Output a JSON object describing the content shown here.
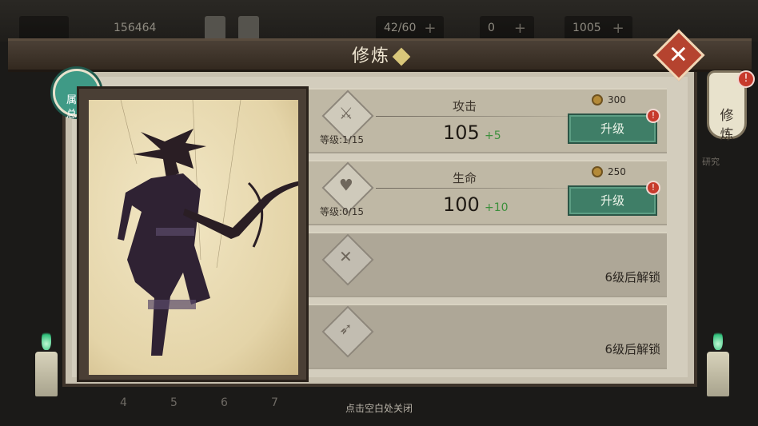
{
  "topbar": {
    "player_id": "156464",
    "stamina": "42/60",
    "currency_1": "0",
    "currency_2": "1005",
    "plus_symbol": "+"
  },
  "dialog": {
    "title": "修炼",
    "attribute_overview_label": "属性\n总览",
    "side_tab_label": "修\n炼",
    "side_hint": "研究",
    "close_symbol": "✕",
    "bottom_hint": "点击空白处关闭",
    "alert_symbol": "!"
  },
  "stats": [
    {
      "name": "攻击",
      "level": "等级:1/15",
      "value": "105",
      "bonus": "+5",
      "cost": "300",
      "button": "升级",
      "icon": "sword-icon"
    },
    {
      "name": "生命",
      "level": "等级:0/15",
      "value": "100",
      "bonus": "+10",
      "cost": "250",
      "button": "升级",
      "icon": "heart-plus-icon"
    }
  ],
  "locked": [
    {
      "text": "6级后解锁",
      "icon": "crossed-blades-icon"
    },
    {
      "text": "6级后解锁",
      "icon": "bow-icon"
    }
  ],
  "background_numbers": [
    "4",
    "5",
    "6",
    "7"
  ],
  "colors": {
    "accent_green": "#3f7e67",
    "alert_red": "#c73a2c",
    "bonus_green": "#3c8f3c",
    "panel_bg": "#d3cdbd"
  }
}
